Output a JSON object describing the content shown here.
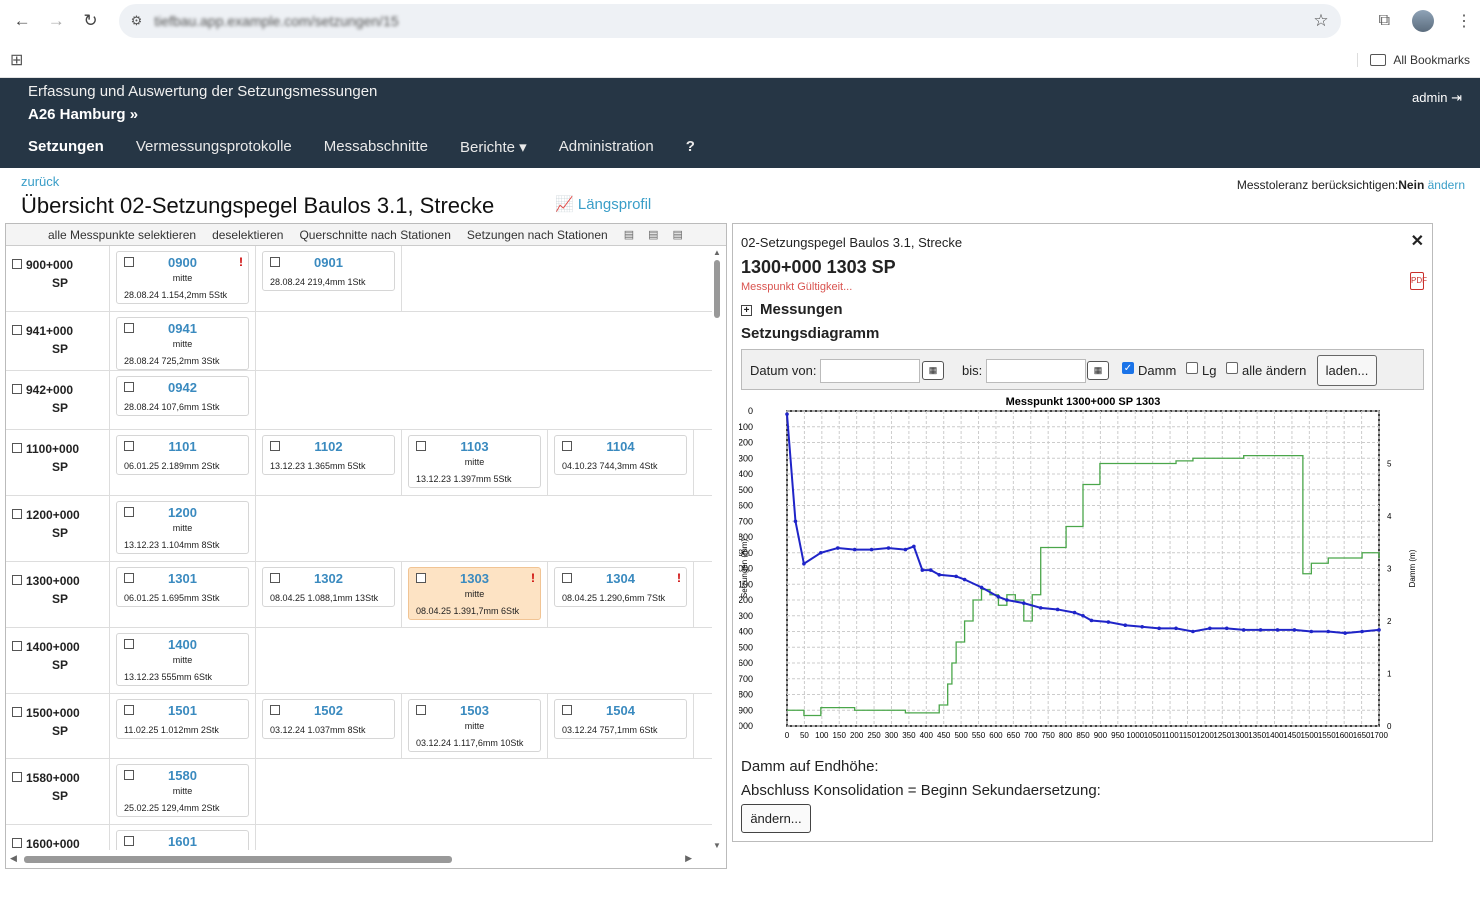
{
  "browser": {
    "url": "tiefbau.app.example.com/setzungen/15",
    "bookmarks_label": "All Bookmarks"
  },
  "header": {
    "subtitle": "Erfassung und Auswertung der Setzungsmessungen",
    "project": "A26 Hamburg »",
    "user": "admin"
  },
  "menu": [
    "Setzungen",
    "Vermessungsprotokolle",
    "Messabschnitte",
    "Berichte ▾",
    "Administration",
    "?"
  ],
  "page": {
    "back": "zurück",
    "title": "Übersicht 02-Setzungspegel Baulos 3.1, Strecke",
    "laengsprofil": "Längsprofil",
    "tol_label": "Messtoleranz berücksichtigen:",
    "tol_value": "Nein",
    "tol_link": "ändern"
  },
  "toolbar": [
    "alle Messpunkte selektieren",
    "deselektieren",
    "Querschnitte nach Stationen",
    "Setzungen nach Stationen"
  ],
  "rows": [
    {
      "station": "900+000",
      "type": "SP",
      "cards": [
        {
          "name": "0900",
          "mid": "mitte",
          "info": "28.08.24 1.154,2mm 5Stk",
          "warn": true
        },
        {
          "name": "0901",
          "mid": "",
          "info": "28.08.24 219,4mm 1Stk"
        }
      ]
    },
    {
      "station": "941+000",
      "type": "SP",
      "cards": [
        {
          "name": "0941",
          "mid": "mitte",
          "info": "28.08.24 725,2mm 3Stk"
        }
      ]
    },
    {
      "station": "942+000",
      "type": "SP",
      "cards": [
        {
          "name": "0942",
          "mid": "",
          "info": "28.08.24 107,6mm 1Stk"
        }
      ]
    },
    {
      "station": "1100+000",
      "type": "SP",
      "cards": [
        {
          "name": "1101",
          "mid": "",
          "info": "06.01.25 2.189mm 2Stk"
        },
        {
          "name": "1102",
          "mid": "",
          "info": "13.12.23 1.365mm 5Stk"
        },
        {
          "name": "1103",
          "mid": "mitte",
          "info": "13.12.23 1.397mm 5Stk"
        },
        {
          "name": "1104",
          "mid": "",
          "info": "04.10.23 744,3mm 4Stk"
        }
      ]
    },
    {
      "station": "1200+000",
      "type": "SP",
      "cards": [
        {
          "name": "1200",
          "mid": "mitte",
          "info": "13.12.23 1.104mm 8Stk"
        }
      ]
    },
    {
      "station": "1300+000",
      "type": "SP",
      "cards": [
        {
          "name": "1301",
          "mid": "",
          "info": "06.01.25 1.695mm 3Stk"
        },
        {
          "name": "1302",
          "mid": "",
          "info": "08.04.25 1.088,1mm 13Stk"
        },
        {
          "name": "1303",
          "mid": "mitte",
          "info": "08.04.25 1.391,7mm 6Stk",
          "warn": true,
          "selected": true
        },
        {
          "name": "1304",
          "mid": "",
          "info": "08.04.25 1.290,6mm 7Stk",
          "warn": true
        }
      ]
    },
    {
      "station": "1400+000",
      "type": "SP",
      "cards": [
        {
          "name": "1400",
          "mid": "mitte",
          "info": "13.12.23 555mm 6Stk"
        }
      ]
    },
    {
      "station": "1500+000",
      "type": "SP",
      "cards": [
        {
          "name": "1501",
          "mid": "",
          "info": "11.02.25 1.012mm 2Stk"
        },
        {
          "name": "1502",
          "mid": "",
          "info": "03.12.24 1.037mm 8Stk"
        },
        {
          "name": "1503",
          "mid": "mitte",
          "info": "03.12.24 1.117,6mm 10Stk"
        },
        {
          "name": "1504",
          "mid": "",
          "info": "03.12.24 757,1mm 6Stk"
        }
      ]
    },
    {
      "station": "1580+000",
      "type": "SP",
      "cards": [
        {
          "name": "1580",
          "mid": "mitte",
          "info": "25.02.25 129,4mm 2Stk"
        }
      ]
    },
    {
      "station": "1600+000",
      "type": "SP",
      "cards": [
        {
          "name": "1601",
          "mid": "",
          "info": ""
        }
      ]
    }
  ],
  "detail": {
    "heading": "02-Setzungspegel Baulos 3.1, Strecke",
    "point": "1300+000 1303 SP",
    "validity": "Messpunkt Gültigkeit...",
    "messungen": "Messungen",
    "diagram": "Setzungsdiagramm",
    "datum_von": "Datum von:",
    "bis": "bis:",
    "damm": "Damm",
    "lg": "Lg",
    "alle": "alle ändern",
    "laden": "laden...",
    "damm_endhoehe": "Damm auf Endhöhe:",
    "abschluss": "Abschluss Konsolidation = Beginn Sekundaersetzung:",
    "aendern": "ändern..."
  },
  "colors": {
    "header": "#263645",
    "link": "#3a9ec8",
    "settlement": "#1f24c8",
    "damm": "#4aa64a"
  },
  "chart_data": {
    "type": "line",
    "title": "Messpunkt 1300+000 SP 1303",
    "ylabel": "Setzungen (mm)",
    "y2label": "Damm (m)",
    "xlabel": "",
    "xlim": [
      0,
      700
    ],
    "ylim": [
      -2000,
      0
    ],
    "y2lim": [
      0,
      6
    ],
    "x_ticks": [
      "0",
      "50",
      "100",
      "150",
      "200",
      "250",
      "300",
      "350",
      "400",
      "450",
      "500",
      "550",
      "600",
      "650",
      "700",
      "750",
      "800",
      "850",
      "900",
      "950",
      "1000",
      "1050",
      "1100",
      "1150",
      "1200",
      "1250",
      "1300",
      "1350",
      "1400",
      "1450",
      "1500",
      "1550",
      "1600",
      "1650",
      "1700"
    ],
    "y_ticks": [
      "0",
      "-100",
      "-200",
      "-300",
      "-400",
      "-500",
      "-600",
      "-700",
      "-800",
      "-900",
      "-1000",
      "-1100",
      "-1200",
      "-1300",
      "-1400",
      "-1500",
      "-1600",
      "-1700",
      "-1800",
      "-1900",
      "-2000"
    ],
    "y2_ticks": [
      "0",
      "1",
      "2",
      "3",
      "4",
      "5"
    ],
    "series": [
      {
        "name": "Setzung",
        "x": [
          0,
          10,
          20,
          40,
          60,
          80,
          100,
          120,
          140,
          150,
          160,
          170,
          180,
          200,
          210,
          230,
          250,
          260,
          280,
          300,
          320,
          340,
          350,
          360,
          380,
          400,
          420,
          440,
          460,
          480,
          500,
          520,
          540,
          560,
          580,
          600,
          620,
          640,
          660,
          680,
          700
        ],
        "y": [
          -20,
          -700,
          -970,
          -900,
          -870,
          -880,
          -880,
          -870,
          -880,
          -860,
          -1010,
          -1010,
          -1040,
          -1050,
          -1070,
          -1120,
          -1180,
          -1200,
          -1220,
          -1250,
          -1260,
          -1280,
          -1300,
          -1330,
          -1340,
          -1360,
          -1370,
          -1380,
          -1380,
          -1400,
          -1380,
          -1380,
          -1390,
          -1390,
          -1390,
          -1390,
          -1400,
          -1400,
          -1410,
          -1400,
          -1390
        ]
      },
      {
        "name": "Damm",
        "x": [
          0,
          10,
          20,
          40,
          80,
          110,
          140,
          160,
          180,
          190,
          195,
          200,
          210,
          220,
          230,
          240,
          250,
          260,
          270,
          280,
          290,
          300,
          320,
          330,
          350,
          360,
          370,
          380,
          400,
          420,
          440,
          460,
          480,
          500,
          520,
          540,
          560,
          580,
          600,
          610,
          620,
          640,
          660,
          680,
          700
        ],
        "y": [
          0.3,
          0.3,
          0.2,
          0.35,
          0.3,
          0.3,
          0.25,
          0.25,
          0.4,
          0.8,
          1.2,
          1.6,
          2.0,
          2.4,
          2.6,
          2.5,
          2.3,
          2.5,
          2.4,
          2.0,
          2.5,
          3.4,
          3.4,
          3.8,
          4.6,
          4.6,
          5.0,
          5.0,
          5.0,
          5.0,
          5.0,
          5.05,
          5.1,
          5.1,
          5.1,
          5.15,
          5.15,
          5.15,
          5.15,
          2.9,
          3.1,
          3.2,
          3.2,
          3.3,
          3.2
        ]
      }
    ]
  }
}
